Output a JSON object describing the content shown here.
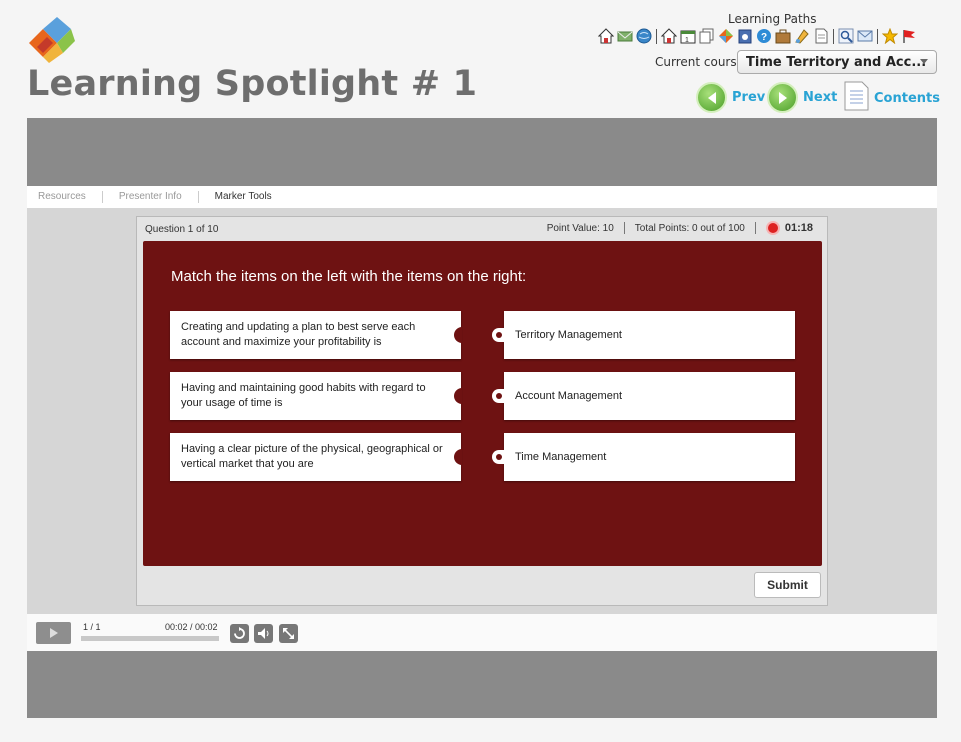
{
  "header": {
    "title": "Learning Spotlight # 1",
    "learning_paths_label": "Learning Paths",
    "current_course_label": "Current course:",
    "current_course_value": "Time Territory and Acc...",
    "prev_label": "Prev",
    "next_label": "Next",
    "contents_label": "Contents"
  },
  "toolbar_icons": [
    "home-icon",
    "email-icon",
    "globe-icon",
    "home-icon",
    "calendar-icon",
    "copy-icon",
    "tag-icon",
    "clipboard-icon",
    "help-icon",
    "briefcase-icon",
    "paint-icon",
    "document-icon",
    "search-icon",
    "feedback-icon",
    "star-icon",
    "flag-icon"
  ],
  "tabs": [
    "Resources",
    "Presenter Info",
    "Marker Tools"
  ],
  "quiz": {
    "question_count": "Question 1 of 10",
    "point_value": "Point Value: 10",
    "total_points": "Total Points: 0 out of 100",
    "timer": "01:18",
    "prompt": "Match the items on the left with the items on the right:",
    "left_items": [
      "Creating and updating a plan to best serve each account and maximize your profitability is",
      "Having and maintaining good habits with regard to your usage of time is",
      "Having a clear picture of the physical, geographical or vertical market that you are"
    ],
    "right_items": [
      "Territory Management",
      "Account Management",
      "Time Management"
    ],
    "submit_label": "Submit"
  },
  "player": {
    "slide_count": "1 / 1",
    "time": "00:02 / 00:02"
  },
  "colors": {
    "panel": "#6e1212",
    "link": "#29a3d4",
    "band": "#8a8a8a"
  }
}
